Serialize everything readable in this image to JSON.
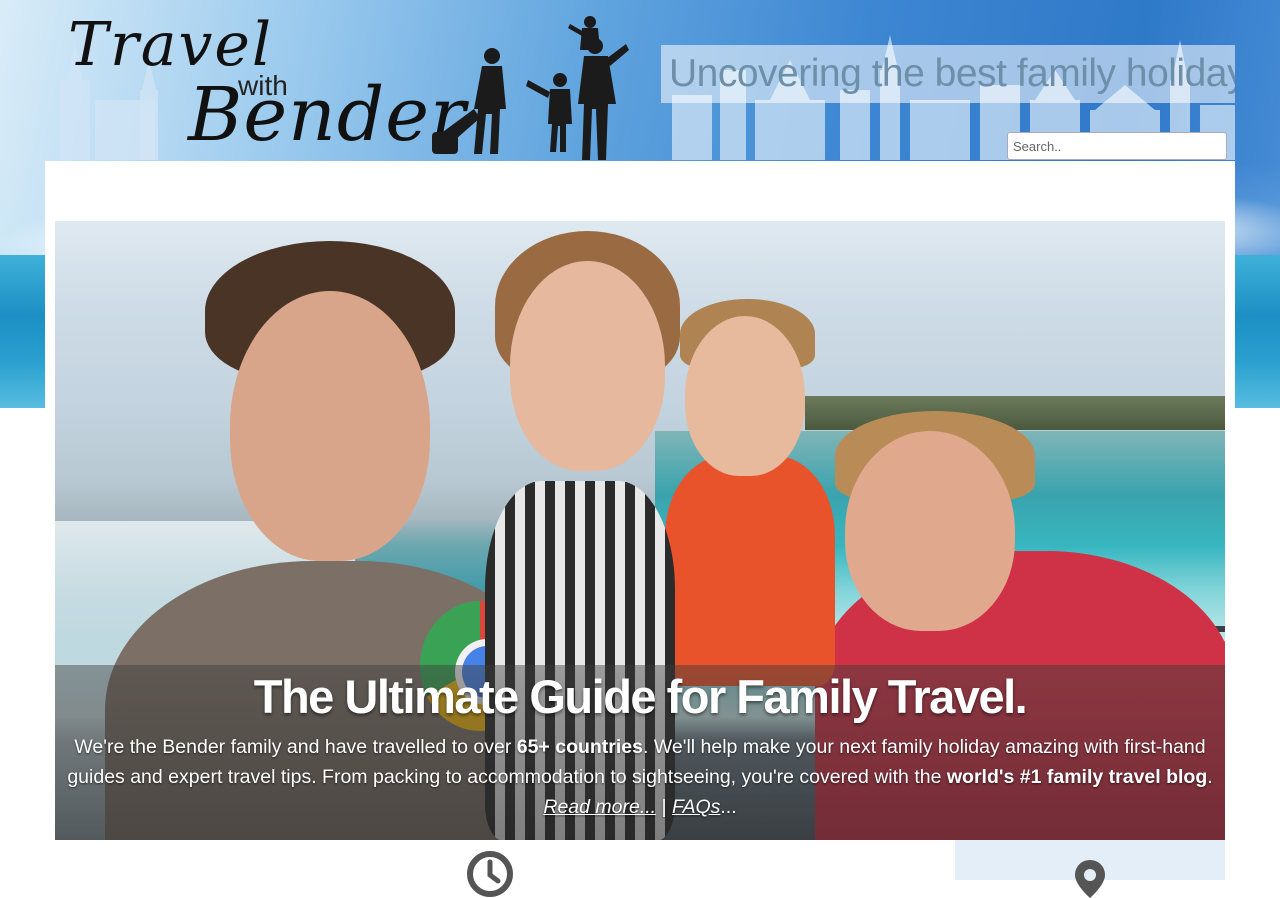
{
  "header": {
    "logo": {
      "line1": "Travel",
      "line2": "with",
      "line3": "Bender"
    },
    "tagline": "Uncovering the best family holidays",
    "search": {
      "placeholder": "Search.."
    }
  },
  "hero": {
    "title": "The Ultimate Guide for Family Travel.",
    "text_part1": "We're the Bender family and have travelled to over ",
    "text_bold1": "65+ countries",
    "text_part2": ". We'll help make your next family holiday amazing with first-hand guides and expert travel tips. From packing to accommodation to sightseeing, you're covered with the ",
    "text_bold2": "world's #1 family travel blog",
    "text_part3": ". ",
    "read_more": "Read more...",
    "separator": " | ",
    "faqs": "FAQs",
    "ellipsis": "..."
  },
  "icons": {
    "clock": "clock-icon",
    "pin": "map-pin-icon",
    "search": "search-icon"
  },
  "colors": {
    "tagline_text": "#6e8fa9",
    "bottom_box": "#e4eef8"
  }
}
